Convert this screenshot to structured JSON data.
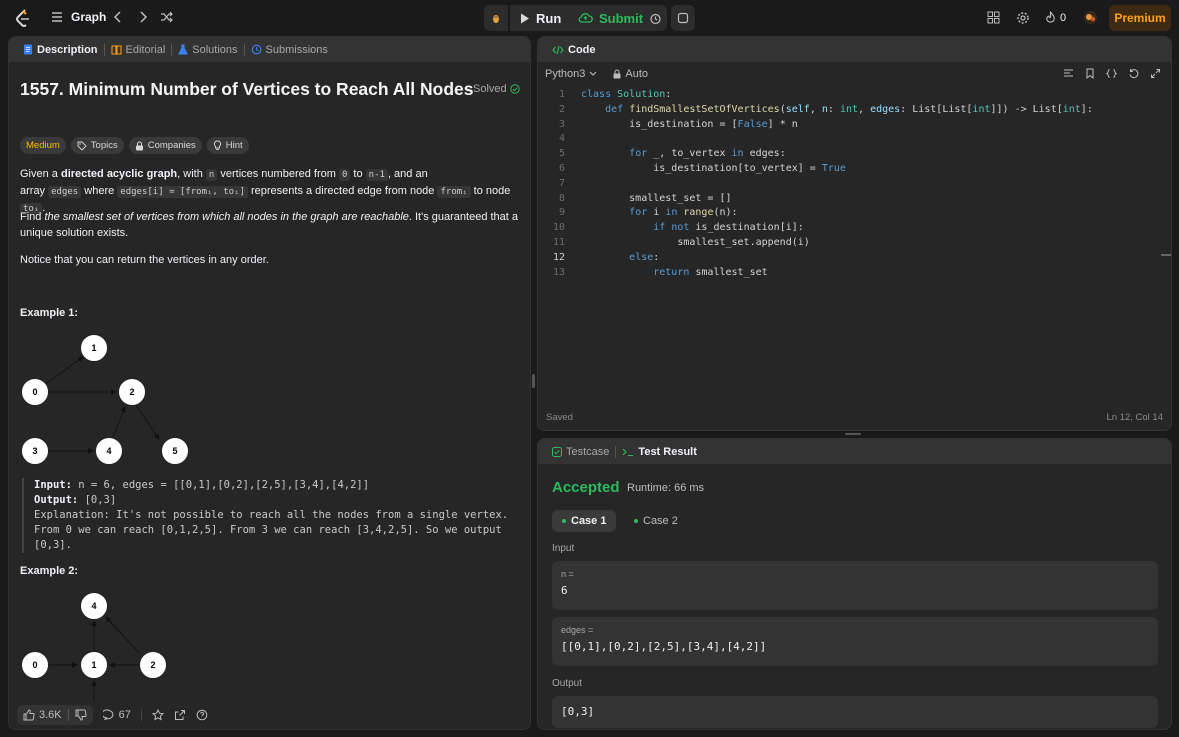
{
  "topbar": {
    "problem_list_label": "Graph",
    "run_label": "Run",
    "submit_label": "Submit",
    "streak_count": "0",
    "premium_label": "Premium"
  },
  "left_tabs": [
    {
      "label": "Description"
    },
    {
      "label": "Editorial"
    },
    {
      "label": "Solutions"
    },
    {
      "label": "Submissions"
    }
  ],
  "problem": {
    "title": "1557. Minimum Number of Vertices to Reach All Nodes",
    "solved_label": "Solved",
    "difficulty": "Medium",
    "topics_label": "Topics",
    "companies_label": "Companies",
    "hint_label": "Hint",
    "desc1_a": "Given a ",
    "desc1_b": "directed acyclic graph",
    "desc1_c": ", with ",
    "desc1_n": "n",
    "desc1_d": " vertices numbered from ",
    "desc1_zero": "0",
    "desc1_e": " to ",
    "desc1_nm1": "n-1",
    "desc1_f": ", and an",
    "desc1_g": "array ",
    "desc1_edges": "edges",
    "desc1_h": " where ",
    "desc1_edgesi": "edges[i] = [fromᵢ, toᵢ]",
    "desc1_i": " represents a directed edge from node ",
    "desc1_from": "fromᵢ",
    "desc1_j": " to node ",
    "desc1_to": "toᵢ",
    "desc1_k": ".",
    "desc2_a": "Find ",
    "desc2_b": "the smallest set of vertices from which all nodes in the graph are reachable",
    "desc2_c": ". It's guaranteed that a unique solution exists.",
    "desc3": "Notice that you can return the vertices in any order.",
    "example1_heading": "Example 1:",
    "example1_input_label": "Input:",
    "example1_input": " n = 6, edges = [[0,1],[0,2],[2,5],[3,4],[4,2]]",
    "example1_output_label": "Output:",
    "example1_output": " [0,3]",
    "example1_expl_1": "Explanation: It's not possible to reach all the nodes from a single vertex.",
    "example1_expl_2": "From 0 we can reach [0,1,2,5]. From 3 we can reach [3,4,2,5]. So we output",
    "example1_expl_3": "[0,3].",
    "example2_heading": "Example 2:",
    "graph1_nodes": [
      "1",
      "0",
      "2",
      "3",
      "4",
      "5"
    ],
    "graph2_nodes": [
      "4",
      "0",
      "1",
      "2"
    ]
  },
  "bottom": {
    "likes": "3.6K",
    "comments": "67"
  },
  "code": {
    "tab_label": "Code",
    "language": "Python3",
    "mode": "Auto",
    "saved_label": "Saved",
    "cursor_pos": "Ln 12, Col 14",
    "current_line": 12
  },
  "result_tabs": [
    {
      "label": "Testcase"
    },
    {
      "label": "Test Result"
    }
  ],
  "result": {
    "status": "Accepted",
    "runtime": "Runtime: 66 ms",
    "case1": "Case 1",
    "case2": "Case 2",
    "input_label": "Input",
    "n_label": "n =",
    "n_value": "6",
    "edges_label": "edges =",
    "edges_value": "[[0,1],[0,2],[2,5],[3,4],[4,2]]",
    "output_label": "Output",
    "output_value": "[0,3]"
  },
  "colors": {
    "accent": "#ffa116",
    "accepted": "#2cbb5d",
    "submit": "#2cbb5d",
    "medium": "#ffb800"
  }
}
